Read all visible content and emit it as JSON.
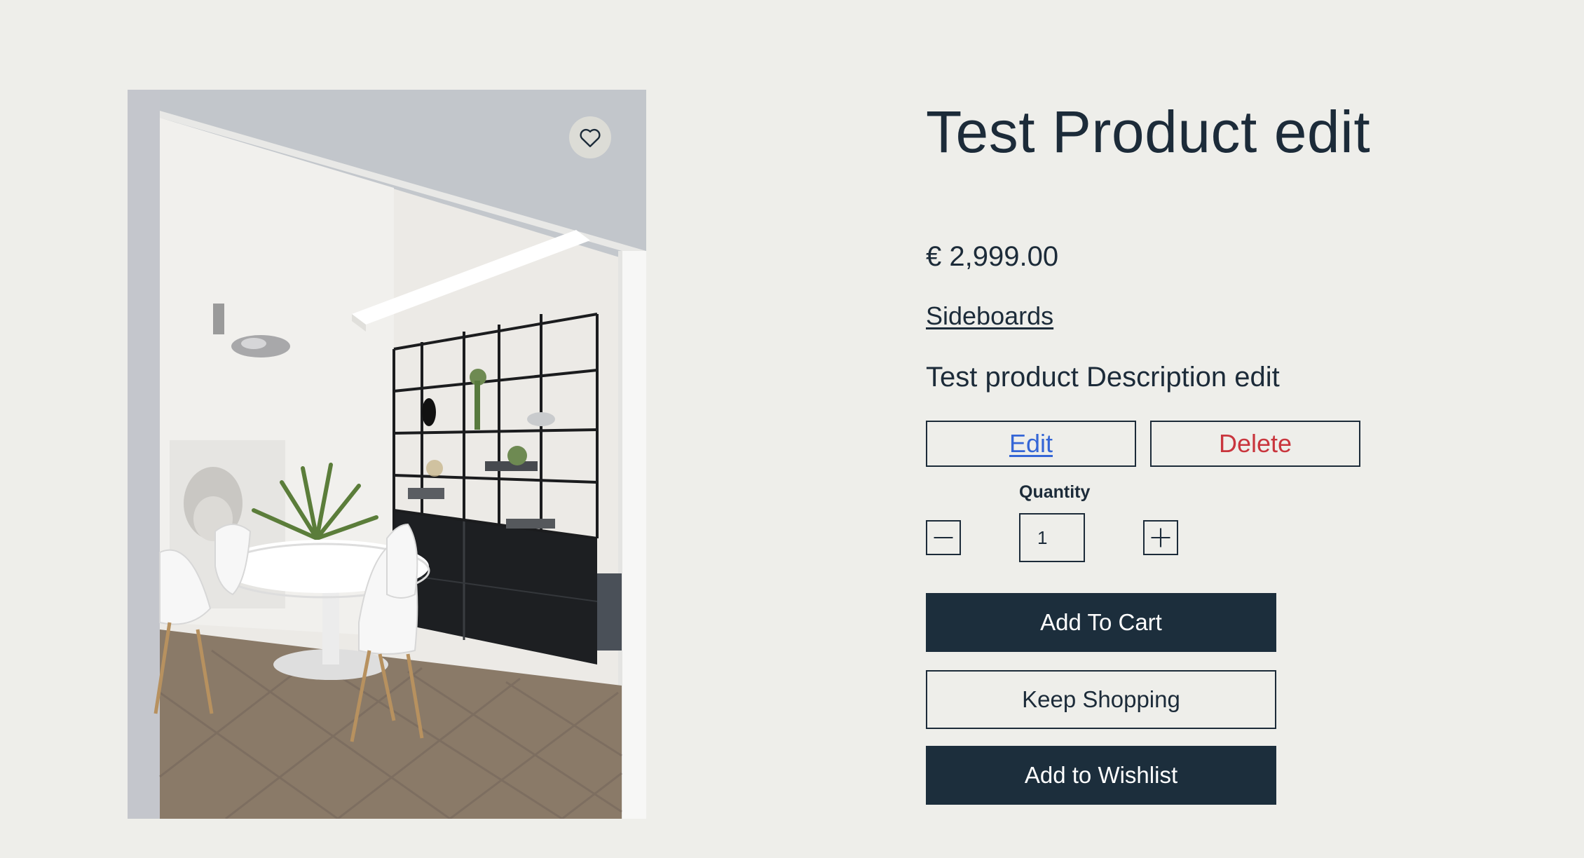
{
  "product": {
    "title": "Test Product edit",
    "price": "€ 2,999.00",
    "category": "Sideboards",
    "description": "Test product Description edit",
    "image_alt": "Dining room with white round table, white chairs and black shelving unit"
  },
  "admin": {
    "edit_label": "Edit",
    "delete_label": "Delete"
  },
  "quantity": {
    "label": "Quantity",
    "value": "1"
  },
  "actions": {
    "add_to_cart": "Add To Cart",
    "keep_shopping": "Keep Shopping",
    "add_to_wishlist": "Add to Wishlist"
  },
  "icons": {
    "wishlist_toggle": "heart-icon",
    "decrease": "minus-icon",
    "increase": "plus-icon"
  },
  "colors": {
    "background": "#eeeeea",
    "text": "#1c2b39",
    "primary_button": "#1c2e3c",
    "edit_link": "#3566d6",
    "delete": "#c9353d"
  }
}
